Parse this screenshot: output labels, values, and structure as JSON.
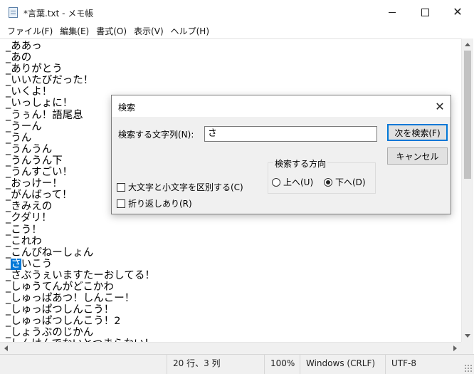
{
  "window": {
    "title": "*言葉.txt - メモ帳",
    "minimize_symbol": "—",
    "maximize_symbol": "☐",
    "close_symbol": "✕"
  },
  "menu": [
    "ファイル(F)",
    "編集(E)",
    "書式(O)",
    "表示(V)",
    "ヘルプ(H)"
  ],
  "editor": {
    "lines": [
      "_ああっ",
      "_あの",
      "_ありがとう",
      "_いいたびだった！",
      "_いくよ！",
      "_いっしょに！",
      "_うぅん！語尾息",
      "_うーん",
      "_うん",
      "_うんうん",
      "_うんうん下",
      "_うんすごい！",
      "_おっけー！",
      "_がんばって！",
      "_きみえの",
      "_クダリ！",
      "_こう！",
      "_これわ",
      "_こんぴねーしょん",
      "_さいこう",
      "_さぶうぇいますたーおしてる！",
      "_しゅうてんがどこかわ",
      "_しゅっぱあつ！しんこー！",
      "_しゅっぱつしんこう！",
      "_しゅっぱつしんこう！2",
      "_しょうぶのじかん",
      "_しんけんでないとつまらない！"
    ],
    "selected_line_index": 19,
    "selected_text": "さ",
    "selection_color": "#0078d7"
  },
  "status": {
    "position": "20 行、3 列",
    "zoom": "100%",
    "line_ending": "Windows (CRLF)",
    "encoding": "UTF-8"
  },
  "find_dialog": {
    "title": "検索",
    "close_symbol": "✕",
    "find_label": "検索する文字列(N):",
    "find_value": "さ",
    "find_next_label": "次を検索(F)",
    "cancel_label": "キャンセル",
    "direction_group_label": "検索する方向",
    "direction_up_label": "上へ(U)",
    "direction_down_label": "下へ(D)",
    "direction_selected": "down",
    "match_case_label": "大文字と小文字を区別する(C)",
    "wrap_label": "折り返しあり(R)",
    "match_case_checked": false,
    "wrap_checked": false,
    "default_button_color": "#0078d7"
  }
}
